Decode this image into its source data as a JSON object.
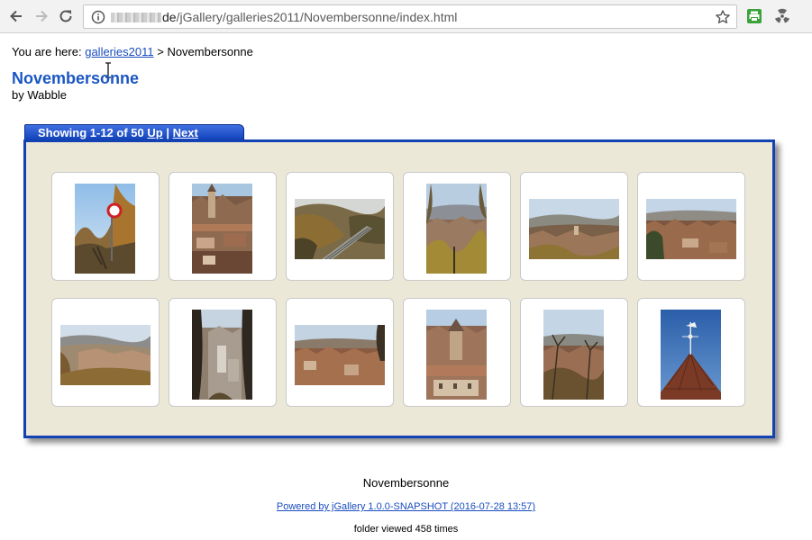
{
  "browser": {
    "url_host_suffix": "de",
    "url_path": "/jGallery/galleries2011/Novembersonne/index.html",
    "icons": [
      "back-arrow-icon",
      "forward-arrow-icon",
      "reload-icon",
      "info-icon",
      "star-icon",
      "printer-extension-icon",
      "radiation-extension-icon"
    ]
  },
  "breadcrumb": {
    "prefix": "You are here:",
    "link_label": "galleries2011",
    "separator": ">",
    "current": "Novembersonne"
  },
  "header": {
    "title": "Novembersonne",
    "author": "by Wabble"
  },
  "gallery": {
    "pager_text": "Showing 1-12 of 50",
    "up_label": "Up",
    "pipe": "|",
    "next_label": "Next",
    "thumbnails": [
      {
        "name": "thumb-1",
        "subject": "traffic-sign-trees",
        "orientation": "portrait"
      },
      {
        "name": "thumb-2",
        "subject": "town-church-tower",
        "orientation": "portrait"
      },
      {
        "name": "thumb-3",
        "subject": "valley-railway",
        "orientation": "landscape"
      },
      {
        "name": "thumb-4",
        "subject": "town-view-trees",
        "orientation": "portrait"
      },
      {
        "name": "thumb-5",
        "subject": "town-panorama-hills",
        "orientation": "landscape"
      },
      {
        "name": "thumb-6",
        "subject": "town-rooftops",
        "orientation": "landscape"
      },
      {
        "name": "thumb-7",
        "subject": "valley-town",
        "orientation": "landscape"
      },
      {
        "name": "thumb-8",
        "subject": "town-between-trees",
        "orientation": "portrait"
      },
      {
        "name": "thumb-9",
        "subject": "town-rooftops-wide",
        "orientation": "landscape"
      },
      {
        "name": "thumb-10",
        "subject": "church-town-center",
        "orientation": "portrait"
      },
      {
        "name": "thumb-11",
        "subject": "town-with-bare-trees",
        "orientation": "portrait"
      },
      {
        "name": "thumb-12",
        "subject": "weather-vane-roof",
        "orientation": "portrait"
      }
    ]
  },
  "footer": {
    "title": "Novembersonne",
    "powered_by": "Powered by jGallery 1.0.0-SNAPSHOT (2016-07-28 13:57)",
    "views": "folder viewed 458 times"
  },
  "colors": {
    "link": "#1a4dbf",
    "title": "#1a56c4",
    "frame_border": "#1342b2",
    "frame_bg": "#ece8d8"
  }
}
